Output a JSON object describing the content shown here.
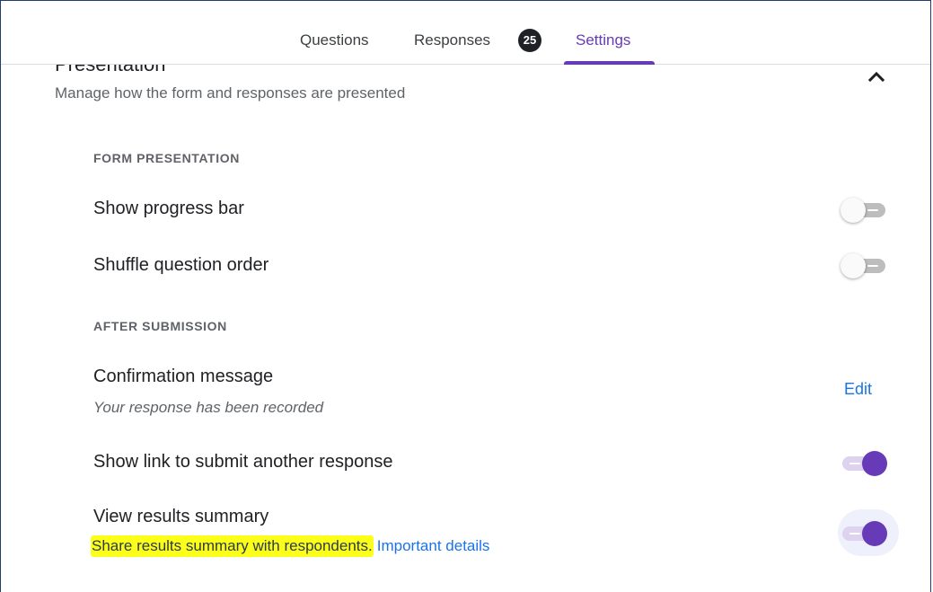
{
  "tabs": {
    "questions_label": "Questions",
    "responses_label": "Responses",
    "responses_count": "25",
    "settings_label": "Settings",
    "active": "Settings"
  },
  "section": {
    "title": "Presentation",
    "subtitle": "Manage how the form and responses are presented",
    "collapse_icon": "chevron-up-icon"
  },
  "form_presentation": {
    "label": "FORM PRESENTATION",
    "show_progress_bar": {
      "label": "Show progress bar",
      "enabled": false
    },
    "shuffle_question_order": {
      "label": "Shuffle question order",
      "enabled": false
    }
  },
  "after_submission": {
    "label": "AFTER SUBMISSION",
    "confirmation_message": {
      "label": "Confirmation message",
      "value": "Your response has been recorded",
      "edit_label": "Edit"
    },
    "show_link_another_response": {
      "label": "Show link to submit another response",
      "enabled": true
    },
    "view_results_summary": {
      "label": "View results summary",
      "description": "Share results summary with respondents.",
      "details_link": "Important details",
      "enabled": true
    }
  },
  "colors": {
    "accent": "#673ab7",
    "link": "#1a73e8",
    "highlight": "#fbff1a",
    "badge_bg": "#202124"
  }
}
